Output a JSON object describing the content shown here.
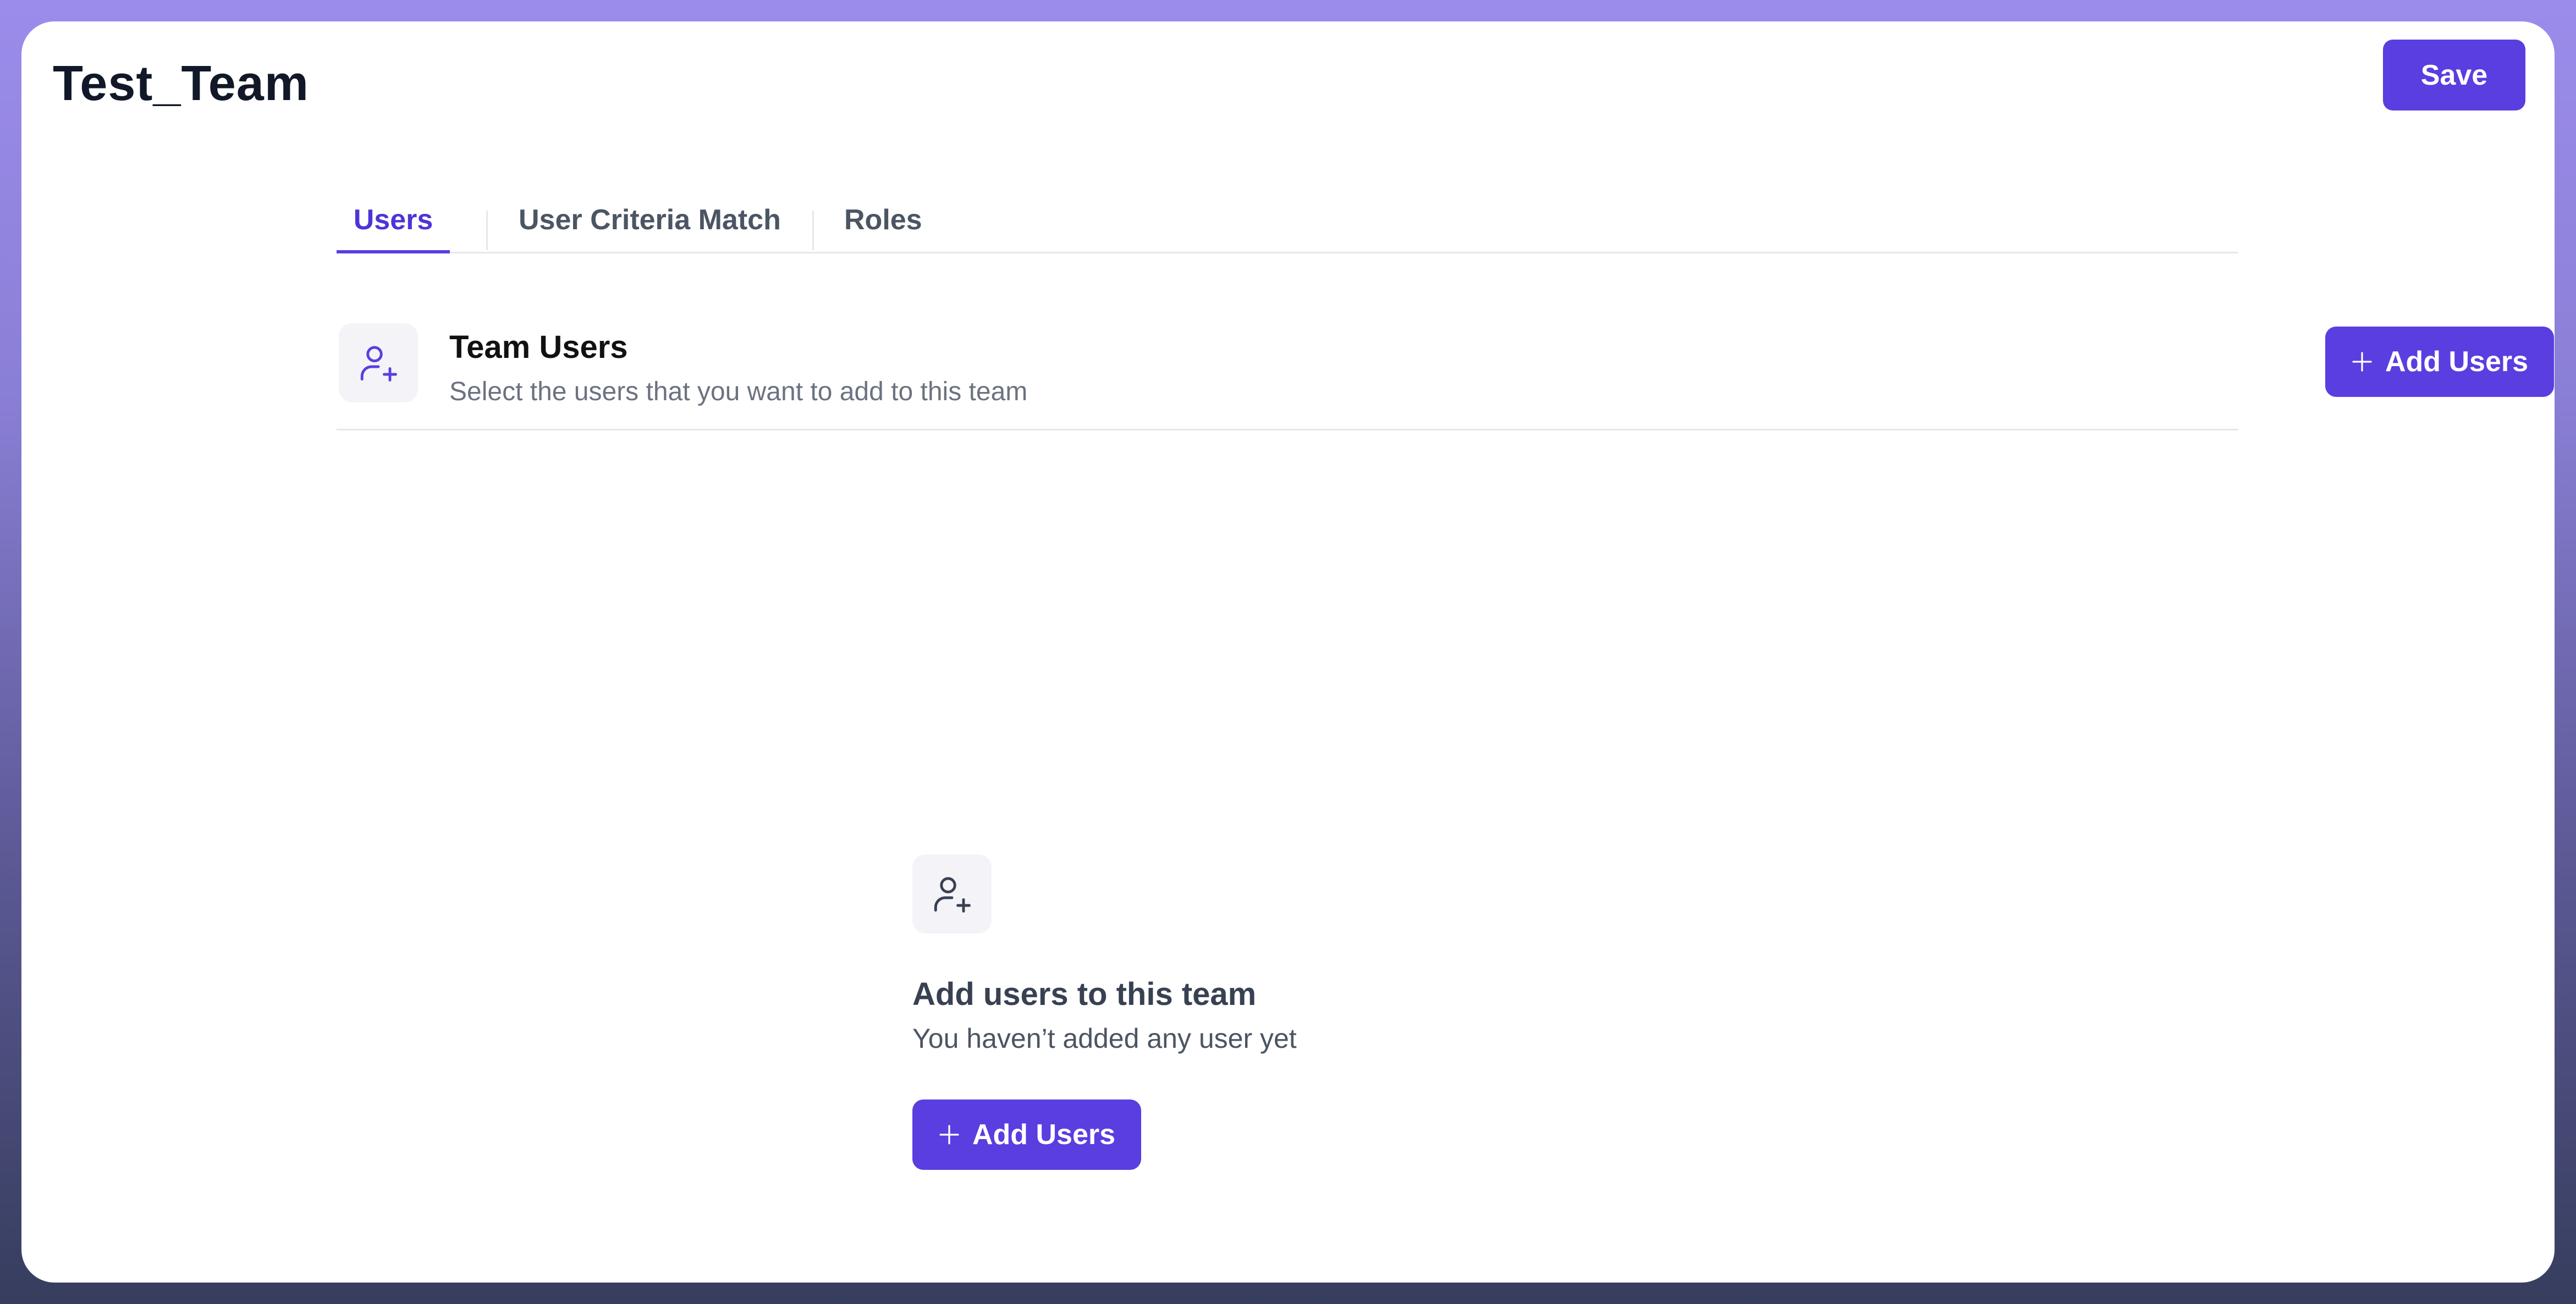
{
  "header": {
    "title": "Test_Team",
    "save_label": "Save"
  },
  "tabs": [
    {
      "label": "Users",
      "active": true
    },
    {
      "label": "User Criteria Match",
      "active": false
    },
    {
      "label": "Roles",
      "active": false
    }
  ],
  "section": {
    "icon": "user-plus-icon",
    "title": "Team Users",
    "subtitle": "Select the users that you want to add to this team",
    "add_button_label": "Add Users"
  },
  "empty_state": {
    "icon": "user-plus-icon",
    "title": "Add users to this team",
    "subtitle": "You haven’t added any user yet",
    "add_button_label": "Add Users"
  },
  "colors": {
    "accent": "#5a3ee0",
    "active_tab_text": "#4c35d6",
    "title_text": "#111827",
    "muted_text": "#6b7280",
    "icon_bg": "#f4f3f8"
  }
}
